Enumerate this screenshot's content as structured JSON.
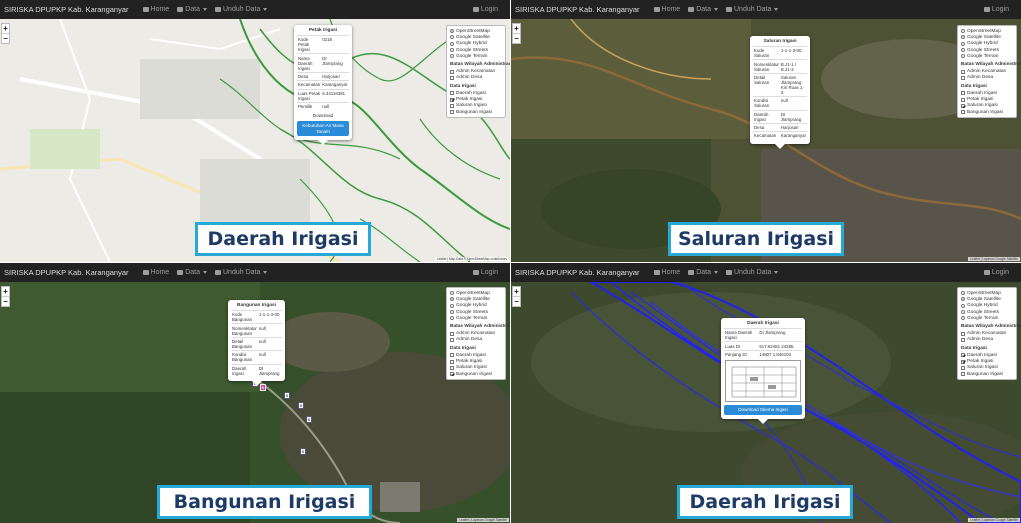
{
  "nav": {
    "brand": "SIRISKA DPUPKP Kab. Karanganyar",
    "home": "Home",
    "data": "Data",
    "unduh": "Unduh Data",
    "login": "Login"
  },
  "layers": {
    "base": [
      "OpenStreetMap",
      "Google Satellite",
      "Google Hybrid",
      "Google Streets",
      "Google Terrain"
    ],
    "admin_title": "Batas Wilayah Administrasi",
    "admin": [
      "Admin Kecamatan",
      "Admin Desa"
    ],
    "irigasi_title": "Data Irigasi",
    "irigasi": [
      "Daerah Irigasi",
      "Petak Irigasi",
      "Saluran Irigasi",
      "Bangunan Irigasi"
    ]
  },
  "panels": [
    {
      "ribbon": "Daerah Irigasi",
      "popup": {
        "title": "Petak Irigasi",
        "rows": [
          [
            "Kode Petak Irigasi",
            "0218"
          ],
          [
            "Nama Daerah Irigasi",
            "DI Jlamprang"
          ],
          [
            "Desa",
            "Harjosari"
          ],
          [
            "Kecamatan",
            "Karanganyar"
          ],
          [
            "Luas Petak Irigasi",
            "6.34116381"
          ],
          [
            "Pemilik",
            "null"
          ]
        ],
        "download": "Download",
        "button": "Kebutuhan Air Masa Tanam"
      },
      "attribution": "Leaflet | Map Data © OpenStreetMap contributors"
    },
    {
      "ribbon": "Saluran Irigasi",
      "popup": {
        "title": "Saluran Irigasi",
        "rows": [
          [
            "Kode Saluran",
            "1-1-1-3-00"
          ],
          [
            "Nomenklatur Saluran",
            "B.J1-1 / B.J1-3"
          ],
          [
            "Detail Saluran",
            "Saluran Jlamprang Kiri Ruas 1-3"
          ],
          [
            "Kondisi Saluran",
            "null"
          ],
          [
            "Daerah Irigasi",
            "DI Jlamprang"
          ],
          [
            "Desa",
            "Harjosari"
          ],
          [
            "Kecamatan",
            "Karanganyar"
          ]
        ]
      },
      "attribution": "Leaflet | Layanan Google Satellite"
    },
    {
      "ribbon": "Bangunan Irigasi",
      "popup": {
        "title": "Bangunan Irigasi",
        "rows": [
          [
            "Kode Bangunan",
            "1-1-1-3-00"
          ],
          [
            "Nomenklatur Bangunan",
            "null"
          ],
          [
            "Detail Bangunan",
            "null"
          ],
          [
            "Kondisi Bangunan",
            "null"
          ],
          [
            "Daerah Irigasi",
            "DI Jlamprang"
          ]
        ]
      },
      "attribution": "Leaflet | Layanan Google Satellite"
    },
    {
      "ribbon": "Daerah Irigasi",
      "popup": {
        "title": "Daerah Irigasi",
        "rows": [
          [
            "Nama Daerah Irigasi",
            "DI Jlamprang"
          ],
          [
            "Luas DI",
            "517.62481 24285"
          ],
          [
            "Panjang DI",
            "14807 1.846104"
          ]
        ],
        "button": "Download Skema Irigasi"
      },
      "attribution": "Leaflet | Layanan Google Satellite"
    }
  ]
}
